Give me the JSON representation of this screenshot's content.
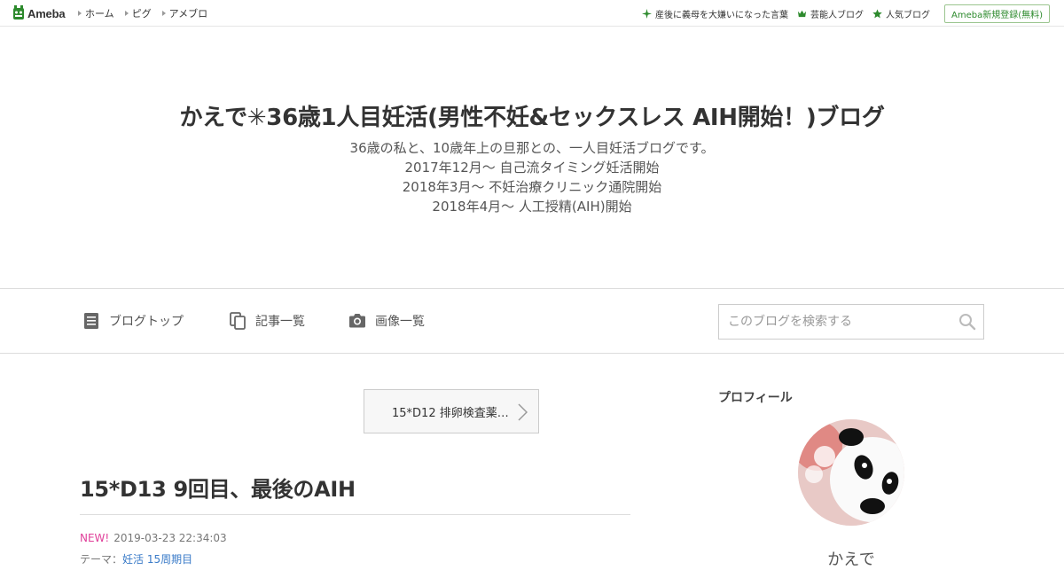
{
  "global": {
    "logo_text": "Ameba",
    "nav": [
      "ホーム",
      "ピグ",
      "アメブロ"
    ],
    "links": [
      {
        "label": "産後に義母を大嫌いになった言葉",
        "icon": "sparkle-icon"
      },
      {
        "label": "芸能人ブログ",
        "icon": "crown-icon"
      },
      {
        "label": "人気ブログ",
        "icon": "star-icon"
      }
    ],
    "signup_label": "Ameba新規登録(無料)",
    "brand_color": "#2d8a2d"
  },
  "blog": {
    "title": "かえで✳︎36歳1人目妊活(男性不妊&セックスレス AIH開始！)ブログ",
    "description": [
      "36歳の私と、10歳年上の旦那との、一人目妊活ブログです。",
      "2017年12月〜 自己流タイミング妊活開始",
      "2018年3月〜 不妊治療クリニック通院開始",
      "2018年4月〜 人工授精(AIH)開始"
    ]
  },
  "blognav": {
    "items": [
      {
        "label": "ブログトップ",
        "icon": "document-icon"
      },
      {
        "label": "記事一覧",
        "icon": "copy-icon"
      },
      {
        "label": "画像一覧",
        "icon": "camera-icon"
      }
    ],
    "search_placeholder": "このブログを検索する"
  },
  "entry": {
    "next_label": "15*D12 排卵検査薬…",
    "title": "15*D13 9回目、最後のAIH",
    "new_badge": "NEW!",
    "datetime": "2019-03-23 22:34:03",
    "theme_prefix": "テーマ：",
    "theme": "妊活 15周期目"
  },
  "sidebar": {
    "heading": "プロフィール",
    "name": "かえで"
  }
}
